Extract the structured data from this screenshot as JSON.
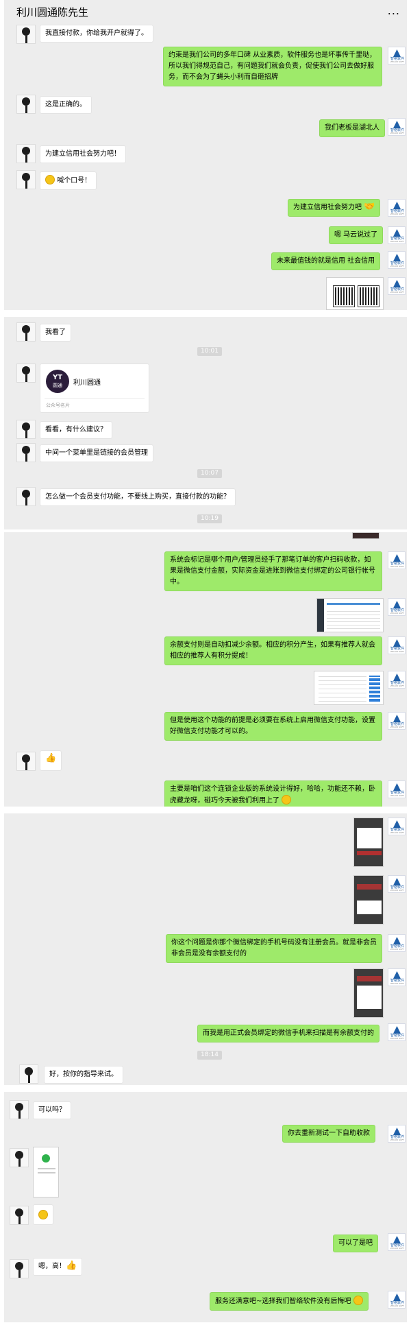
{
  "header": {
    "title": "利川圆通陈先生",
    "more": "..."
  },
  "s1": {
    "m1": "我直接付款，你给我开户就得了。",
    "m2": "约束是我们公司的多年口碑 从业素质，软件服务也是坏事传千里哒，所以我们得规范自己，有问题我们就会负责，促使我们公司去做好服务，而不会为了蝇头小利而自砸招牌",
    "m3": "这是正确的。",
    "m4": "我们老板是湖北人",
    "m5": "为建立信用社会努力吧！",
    "m6": "喊个口号！",
    "m7": "为建立信用社会努力吧",
    "m8": "嗯 马云说过了",
    "m9": "未来最值钱的就是信用 社会信用"
  },
  "s2": {
    "m1": "我看了",
    "t1": "10:01",
    "card_name": "利川圆通",
    "card_label": "公众号名片",
    "logo_text": "YT",
    "logo_sub": "圆通",
    "m2": "看看，有什么建议？",
    "m3": "中间一个菜单里是链接的会员管理",
    "t2": "10:07",
    "m4": "怎么做一个会员支付功能，不要线上购买，直接付款的功能？",
    "t3": "10:19"
  },
  "s3": {
    "m1": "系统会标记是哪个用户/管理员经手了那笔订单的客户扫码收款，如果是微信支付金额，实际资金是进账到微信支付绑定的公司银行帐号中。",
    "m2": "余额支付则是自动扣减少余额。相应的积分产生，如果有推荐人就会相应的推荐人有积分提成！",
    "m3": "但是使用这个功能的前提是必须要在系统上启用微信支付功能，设置好微信支付功能才可以的。",
    "m4": "主要是咱们这个连锁企业版的系统设计得好，哈哈，功能还不赖，卧虎藏龙呀，碰巧今天被我们利用上了"
  },
  "s4": {
    "m1": "你这个问题是你那个微信绑定的手机号码没有注册会员。就是非会员 非会员是没有余额支付的",
    "m2": "而我是用正式会员绑定的微信手机来扫描是有余额支付的",
    "t1": "18:14",
    "m3": "好，按你的指导来试。"
  },
  "s5": {
    "m1": "可以吗？",
    "m2": "你去重新测试一下自助收款",
    "m3": "可以了是吧",
    "m4": "嗯，高！",
    "m5": "服务还满意吧~选择我们智络软件没有后悔吧"
  },
  "rav": {
    "cap": "智络软件",
    "cap2": "ZHILUO SOFT"
  }
}
